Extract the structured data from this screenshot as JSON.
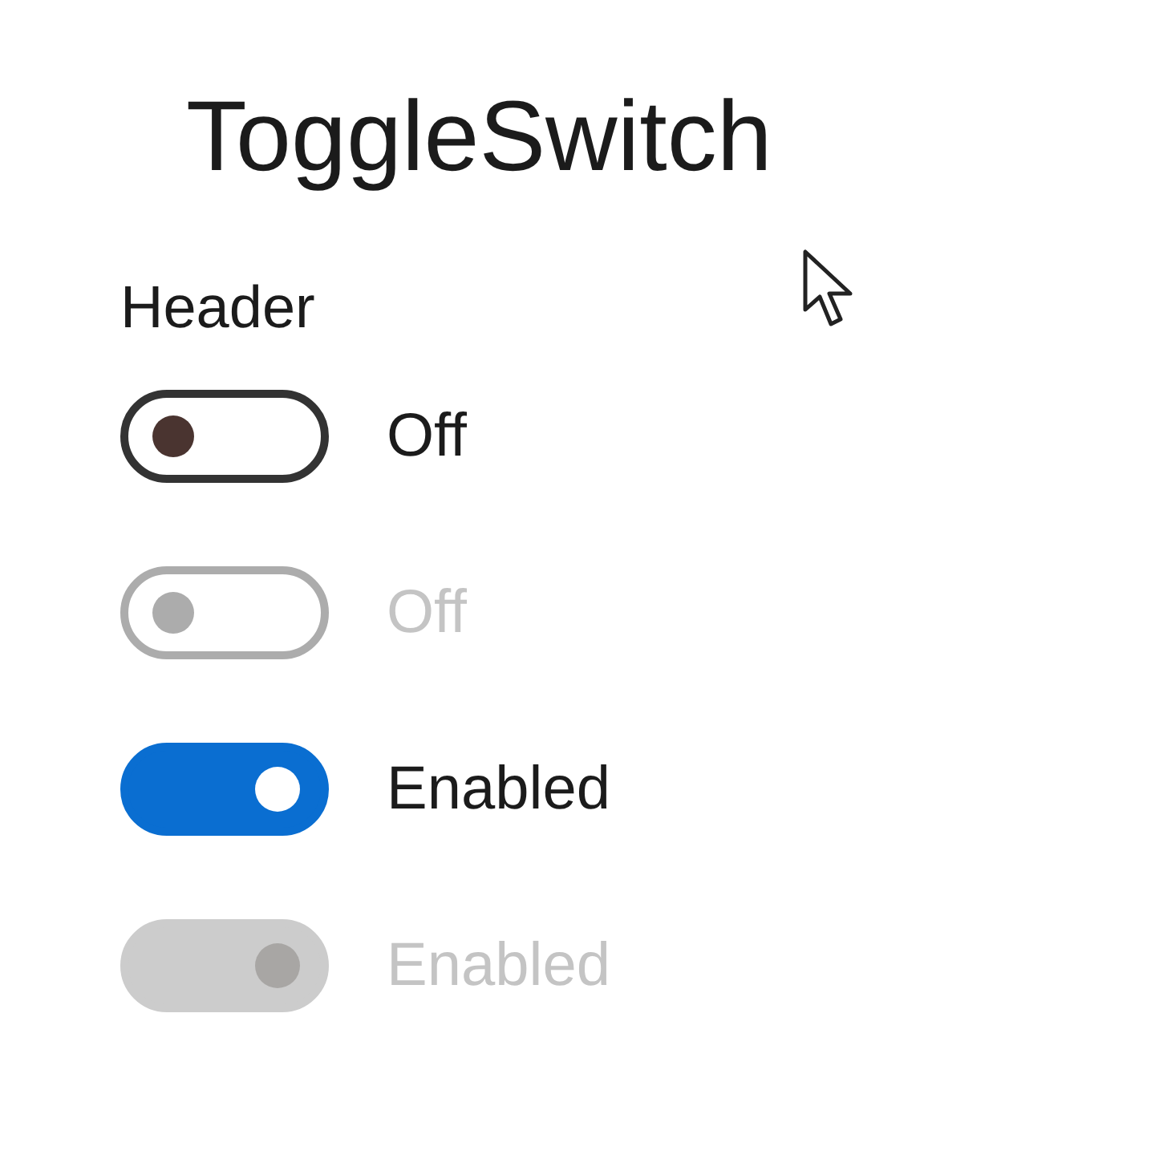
{
  "title": "ToggleSwitch",
  "header": "Header",
  "switches": [
    {
      "label": "Off",
      "on": false,
      "disabled": false
    },
    {
      "label": "Off",
      "on": false,
      "disabled": true
    },
    {
      "label": "Enabled",
      "on": true,
      "disabled": false
    },
    {
      "label": "Enabled",
      "on": true,
      "disabled": true
    }
  ]
}
